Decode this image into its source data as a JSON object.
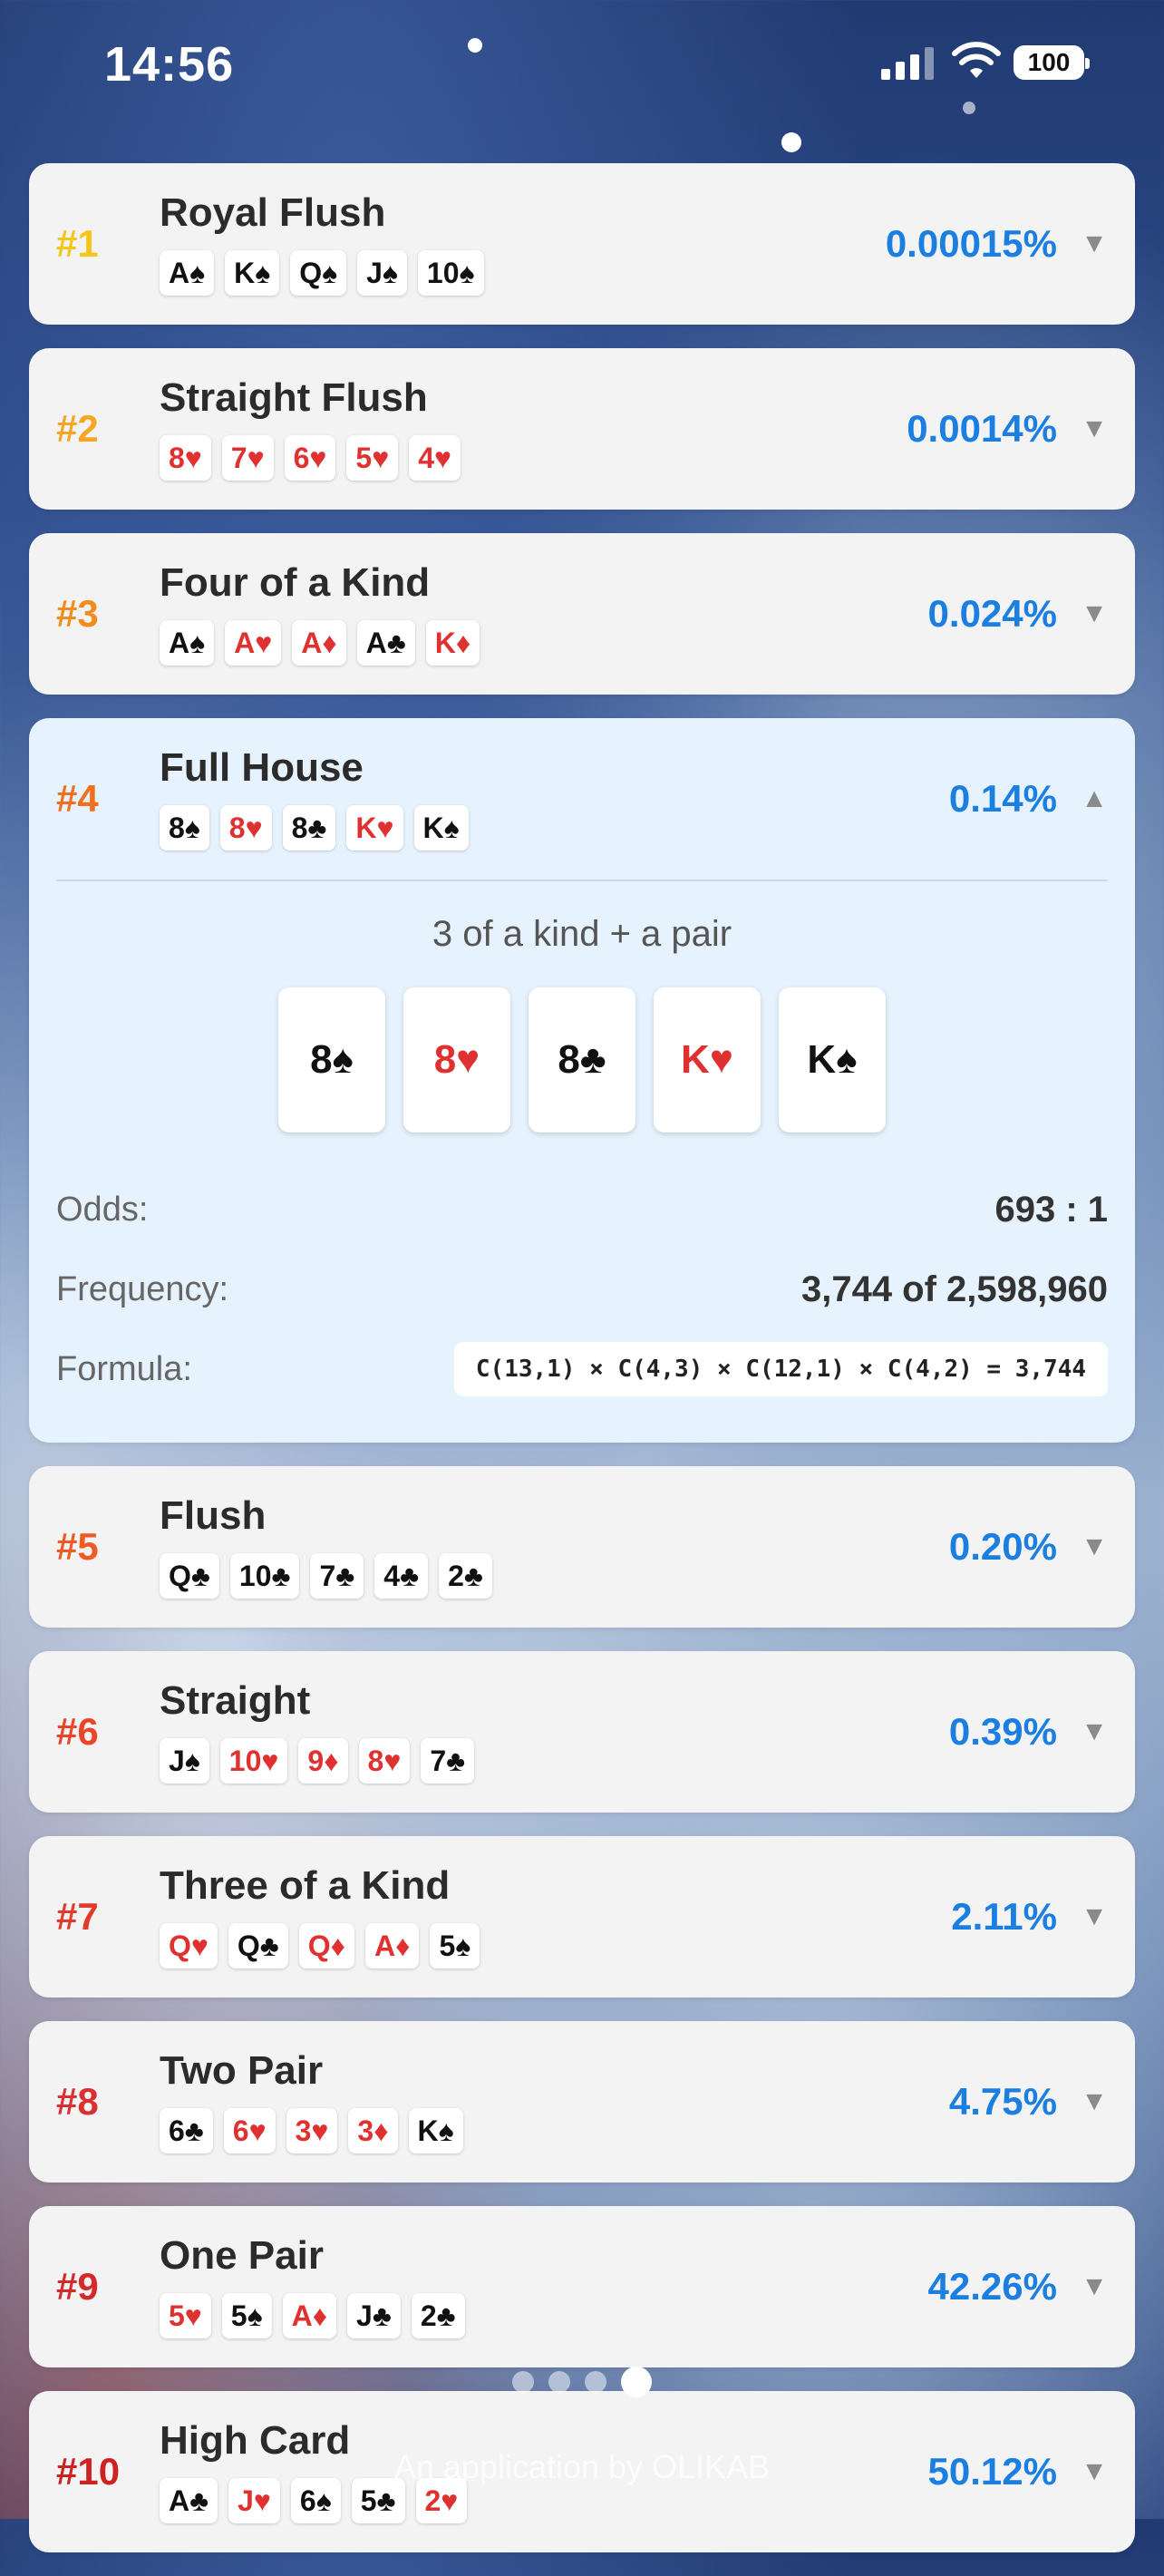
{
  "status_bar": {
    "time": "14:56",
    "battery": "100"
  },
  "hands": [
    {
      "rank": "#1",
      "rank_color": "#f5c518",
      "name": "Royal Flush",
      "probability": "0.00015%",
      "expanded": false,
      "cards": [
        {
          "t": "A♠",
          "c": "black"
        },
        {
          "t": "K♠",
          "c": "black"
        },
        {
          "t": "Q♠",
          "c": "black"
        },
        {
          "t": "J♠",
          "c": "black"
        },
        {
          "t": "10♠",
          "c": "black"
        }
      ]
    },
    {
      "rank": "#2",
      "rank_color": "#f5a623",
      "name": "Straight Flush",
      "probability": "0.0014%",
      "expanded": false,
      "cards": [
        {
          "t": "8♥",
          "c": "red"
        },
        {
          "t": "7♥",
          "c": "red"
        },
        {
          "t": "6♥",
          "c": "red"
        },
        {
          "t": "5♥",
          "c": "red"
        },
        {
          "t": "4♥",
          "c": "red"
        }
      ]
    },
    {
      "rank": "#3",
      "rank_color": "#f28c1c",
      "name": "Four of a Kind",
      "probability": "0.024%",
      "expanded": false,
      "cards": [
        {
          "t": "A♠",
          "c": "black"
        },
        {
          "t": "A♥",
          "c": "red"
        },
        {
          "t": "A♦",
          "c": "red"
        },
        {
          "t": "A♣",
          "c": "black"
        },
        {
          "t": "K♦",
          "c": "red"
        }
      ]
    },
    {
      "rank": "#4",
      "rank_color": "#f07020",
      "name": "Full House",
      "probability": "0.14%",
      "expanded": true,
      "cards": [
        {
          "t": "8♠",
          "c": "black"
        },
        {
          "t": "8♥",
          "c": "red"
        },
        {
          "t": "8♣",
          "c": "black"
        },
        {
          "t": "K♥",
          "c": "red"
        },
        {
          "t": "K♠",
          "c": "black"
        }
      ],
      "details": {
        "description": "3 of a kind + a pair",
        "odds_label": "Odds:",
        "odds_value": "693 : 1",
        "frequency_label": "Frequency:",
        "frequency_value": "3,744 of 2,598,960",
        "formula_label": "Formula:",
        "formula_value": "C(13,1) × C(4,3) × C(12,1) × C(4,2) = 3,744"
      }
    },
    {
      "rank": "#5",
      "rank_color": "#ef5a22",
      "name": "Flush",
      "probability": "0.20%",
      "expanded": false,
      "cards": [
        {
          "t": "Q♣",
          "c": "black"
        },
        {
          "t": "10♣",
          "c": "black"
        },
        {
          "t": "7♣",
          "c": "black"
        },
        {
          "t": "4♣",
          "c": "black"
        },
        {
          "t": "2♣",
          "c": "black"
        }
      ]
    },
    {
      "rank": "#6",
      "rank_color": "#eb4528",
      "name": "Straight",
      "probability": "0.39%",
      "expanded": false,
      "cards": [
        {
          "t": "J♠",
          "c": "black"
        },
        {
          "t": "10♥",
          "c": "red"
        },
        {
          "t": "9♦",
          "c": "red"
        },
        {
          "t": "8♥",
          "c": "red"
        },
        {
          "t": "7♣",
          "c": "black"
        }
      ]
    },
    {
      "rank": "#7",
      "rank_color": "#e33a2c",
      "name": "Three of a Kind",
      "probability": "2.11%",
      "expanded": false,
      "cards": [
        {
          "t": "Q♥",
          "c": "red"
        },
        {
          "t": "Q♣",
          "c": "black"
        },
        {
          "t": "Q♦",
          "c": "red"
        },
        {
          "t": "A♦",
          "c": "red"
        },
        {
          "t": "5♠",
          "c": "black"
        }
      ]
    },
    {
      "rank": "#8",
      "rank_color": "#dc3030",
      "name": "Two Pair",
      "probability": "4.75%",
      "expanded": false,
      "cards": [
        {
          "t": "6♣",
          "c": "black"
        },
        {
          "t": "6♥",
          "c": "red"
        },
        {
          "t": "3♥",
          "c": "red"
        },
        {
          "t": "3♦",
          "c": "red"
        },
        {
          "t": "K♠",
          "c": "black"
        }
      ]
    },
    {
      "rank": "#9",
      "rank_color": "#d42a2a",
      "name": "One Pair",
      "probability": "42.26%",
      "expanded": false,
      "cards": [
        {
          "t": "5♥",
          "c": "red"
        },
        {
          "t": "5♠",
          "c": "black"
        },
        {
          "t": "A♦",
          "c": "red"
        },
        {
          "t": "J♣",
          "c": "black"
        },
        {
          "t": "2♣",
          "c": "black"
        }
      ]
    },
    {
      "rank": "#10",
      "rank_color": "#cc2222",
      "name": "High Card",
      "probability": "50.12%",
      "expanded": false,
      "cards": [
        {
          "t": "A♣",
          "c": "black"
        },
        {
          "t": "J♥",
          "c": "red"
        },
        {
          "t": "6♠",
          "c": "black"
        },
        {
          "t": "5♣",
          "c": "black"
        },
        {
          "t": "2♥",
          "c": "red"
        }
      ]
    }
  ],
  "footer": "An application by OLIKAB"
}
